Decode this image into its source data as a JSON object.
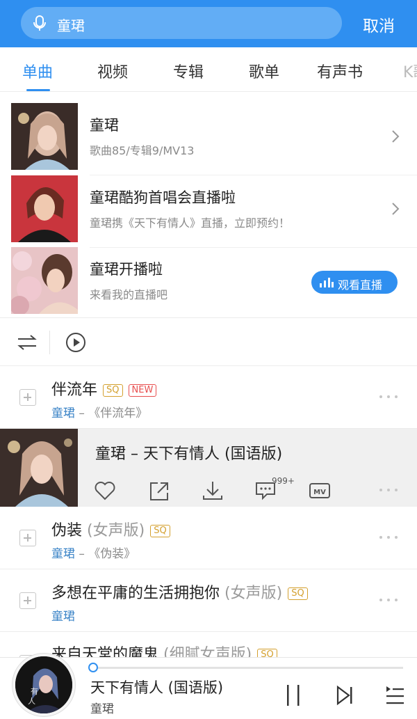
{
  "header": {
    "query": "童珺",
    "cancel_label": "取消"
  },
  "tabs": [
    {
      "label": "单曲",
      "active": true
    },
    {
      "label": "视频"
    },
    {
      "label": "专辑"
    },
    {
      "label": "歌单"
    },
    {
      "label": "有声书"
    },
    {
      "label": "K歌"
    }
  ],
  "artist_cards": [
    {
      "title": "童珺",
      "subtitle": "歌曲85/专辑9/MV13"
    },
    {
      "title": "童珺酷狗首唱会直播啦",
      "subtitle": "童珺携《天下有情人》直播，立即预约！"
    },
    {
      "title": "童珺开播啦",
      "subtitle": "来看我的直播吧",
      "button_label": "观看直播"
    }
  ],
  "songs": [
    {
      "title": "伴流年",
      "badges": [
        "SQ",
        "NEW"
      ],
      "artist": "童珺",
      "album": " – 《伴流年》"
    },
    {
      "title": "伪装",
      "note": " (女声版)",
      "badges": [
        "SQ"
      ],
      "artist": "童珺",
      "album": " – 《伪装》"
    },
    {
      "title": "多想在平庸的生活拥抱你",
      "note": " (女声版)",
      "badges": [
        "SQ"
      ],
      "artist": "童珺"
    },
    {
      "title": "来自天堂的魔鬼",
      "note": " (细腻女声版)",
      "badges": [
        "SQ"
      ]
    }
  ],
  "expanded_song": {
    "title": "童珺 – 天下有情人 (国语版)",
    "comment_count": "999+"
  },
  "player": {
    "title": "天下有情人 (国语版)",
    "artist": "童珺",
    "progress": 0
  },
  "colors": {
    "accent": "#2f8ff0",
    "sq_badge": "#d4a02e",
    "new_badge": "#e84f4f"
  }
}
